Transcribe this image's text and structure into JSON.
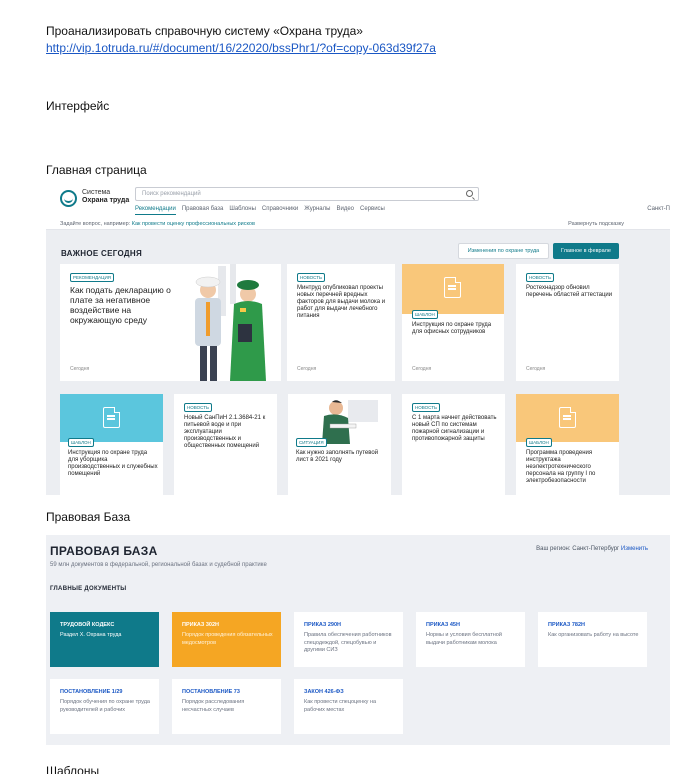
{
  "doc": {
    "heading": "Проанализировать справочную систему «Охрана труда»",
    "link": "http://vip.1otruda.ru/#/document/16/22020/bssPhr1/?of=copy-063d39f27a",
    "section_interface": "Интерфейс",
    "section_main_page": "Главная страница",
    "section_legal_base": "Правовая База",
    "section_templates": "Шаблоны"
  },
  "main_page": {
    "logo_line1": "Система",
    "logo_line2": "Охрана труда",
    "search_placeholder": "Поиск рекомендаций",
    "nav": [
      "Рекомендации",
      "Правовая база",
      "Шаблоны",
      "Справочники",
      "Журналы",
      "Видео",
      "Сервисы"
    ],
    "region_short": "Санкт-П",
    "hint_prefix": "Задайте вопрос, например:",
    "hint_link": "Как провести оценку профессиональных рисков",
    "hint_right": "Развернуть подсказку",
    "important_title": "ВАЖНОЕ СЕГОДНЯ",
    "btn_changes": "Изменения по охране труда",
    "btn_february": "Главное в феврале",
    "cards_row1": [
      {
        "tag": "РЕКОМЕНДАЦИЯ",
        "text": "Как подать декларацию о плате за негативное воздействие на окружающую среду",
        "date": "Сегодня"
      },
      {
        "tag": "НОВОСТЬ",
        "text": "Минтруд опубликовал проекты новых перечней вредных факторов для выдачи молока и работ для выдачи лечебного питания",
        "date": "Сегодня"
      },
      {
        "tag": "ШАБЛОН",
        "text": "Инструкция по охране труда для офисных сотрудников",
        "date": "Сегодня"
      },
      {
        "tag": "НОВОСТЬ",
        "text": "Ростехнадзор обновил перечень областей аттестации",
        "date": "Сегодня"
      }
    ],
    "cards_row2": [
      {
        "tag": "ШАБЛОН",
        "text": "Инструкция по охране труда для уборщика производственных и служебных помещений"
      },
      {
        "tag": "НОВОСТЬ",
        "text": "Новый СанПиН 2.1.3684-21 к питьевой воде и при эксплуатации производственных и общественных помещений"
      },
      {
        "tag": "СИТУАЦИЯ",
        "text": "Как нужно заполнять путевой лист в 2021 году"
      },
      {
        "tag": "НОВОСТЬ",
        "text": "С 1 марта начнет действовать новый СП по системам пожарной сигнализации и противопожарной защиты"
      },
      {
        "tag": "ШАБЛОН",
        "text": "Программа проведения инструктажа неэлектротехнического персонала на группу I по электробезопасности"
      }
    ],
    "colors": {
      "accent": "#0f7a8a",
      "orange": "#f9c77a",
      "blue": "#5bc6dd"
    }
  },
  "legal_base": {
    "title": "ПРАВОВАЯ БАЗА",
    "subtitle": "59 млн документов в федеральной, региональной базах и судебной практике",
    "region_label": "Ваш регион: Санкт-Петербург",
    "region_change": "Изменить",
    "main_docs": "ГЛАВНЫЕ ДОКУМЕНТЫ",
    "docs": [
      {
        "title": "ТРУДОВОЙ КОДЕКС",
        "desc": "Раздел X. Охрана труда",
        "style": "teal"
      },
      {
        "title": "ПРИКАЗ 302Н",
        "desc": "Порядок проведения обязательных медосмотров",
        "style": "orange"
      },
      {
        "title": "ПРИКАЗ 290Н",
        "desc": "Правила обеспечения работников спецодеждой, спецобувью и другими СИЗ",
        "style": "white"
      },
      {
        "title": "ПРИКАЗ 45Н",
        "desc": "Нормы и условия бесплатной выдачи работникам молока",
        "style": "white"
      },
      {
        "title": "ПРИКАЗ 782Н",
        "desc": "Как организовать работу на высоте",
        "style": "white"
      },
      {
        "title": "ПОСТАНОВЛЕНИЕ 1/29",
        "desc": "Порядок обучения по охране труда руководителей и рабочих",
        "style": "white"
      },
      {
        "title": "ПОСТАНОВЛЕНИЕ 73",
        "desc": "Порядок расследования несчастных случаев",
        "style": "white"
      },
      {
        "title": "ЗАКОН 426-ФЗ",
        "desc": "Как провести спецоценку на рабочих местах",
        "style": "white"
      }
    ]
  }
}
